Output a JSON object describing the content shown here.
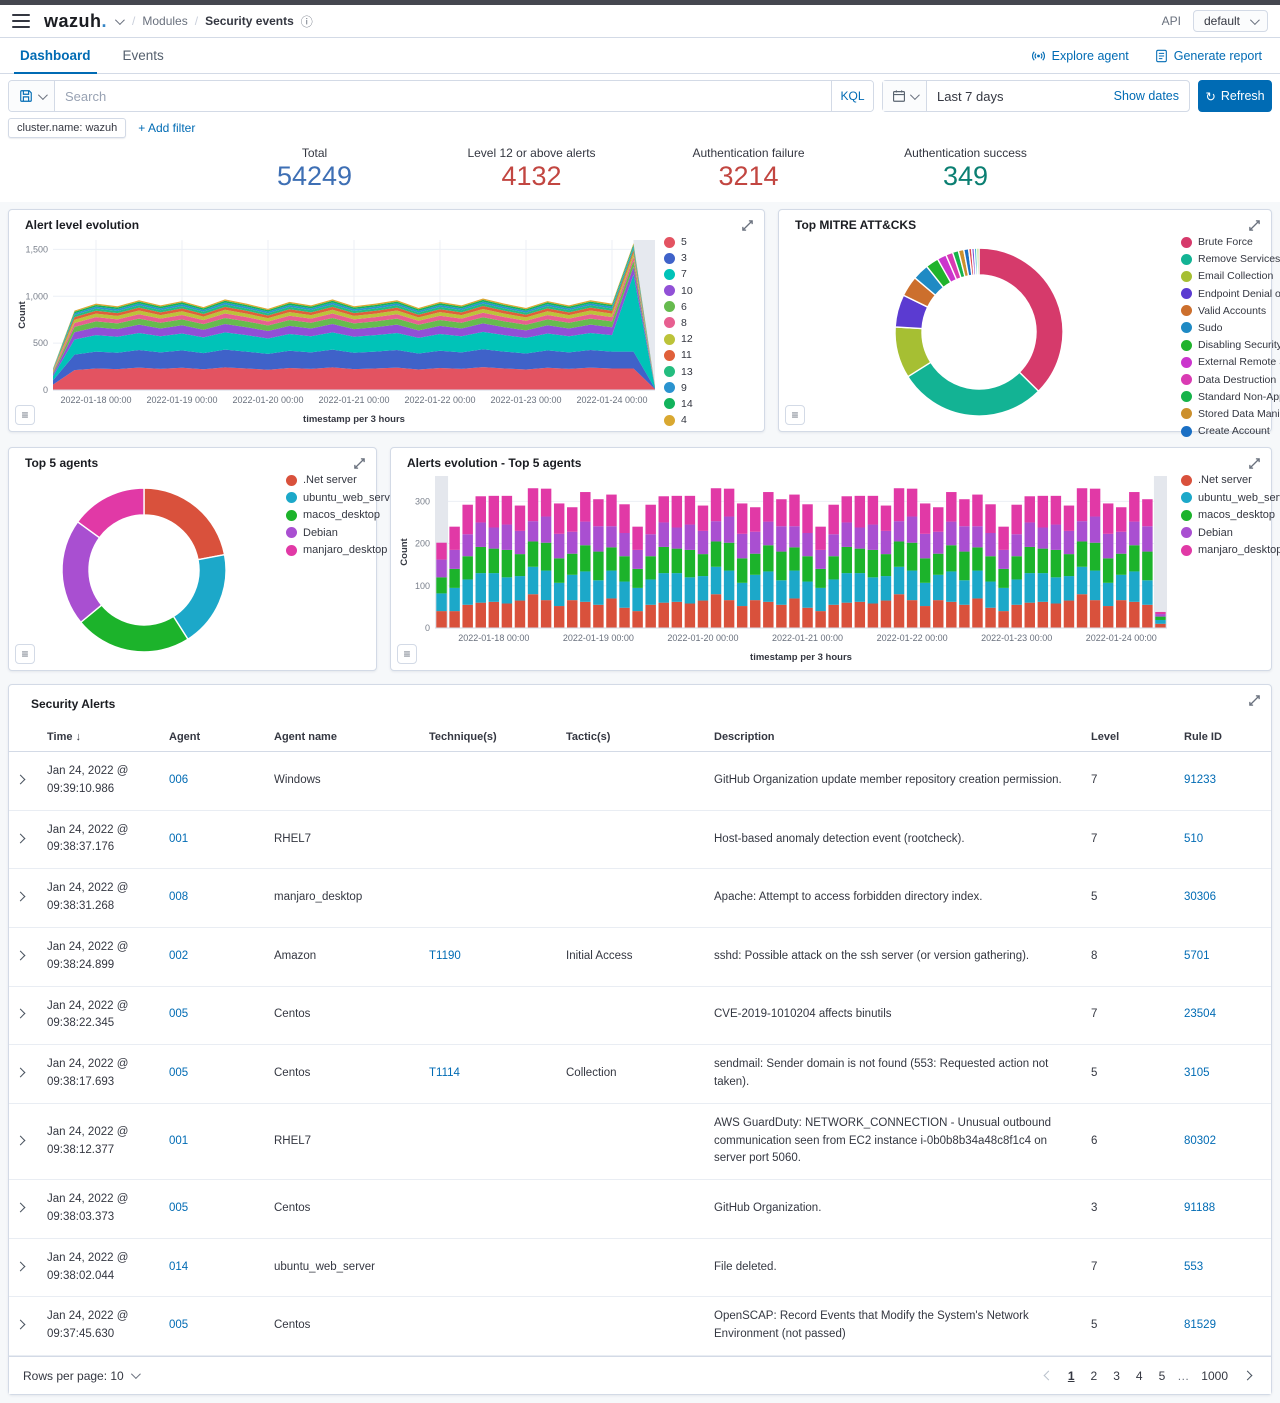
{
  "chrome": {
    "logo_text": "wazuh",
    "logo_dot": ".",
    "breadcrumb": {
      "section": "Modules",
      "current": "Security events"
    },
    "info_glyph": "ⓘ",
    "api_label": "API",
    "api_value": "default"
  },
  "tabs": {
    "items": [
      {
        "label": "Dashboard",
        "active": true
      },
      {
        "label": "Events",
        "active": false
      }
    ],
    "explore_agent": "Explore agent",
    "generate_report": "Generate report"
  },
  "query": {
    "search_placeholder": "Search",
    "kql_label": "KQL",
    "time_range": "Last 7 days",
    "show_dates": "Show dates",
    "refresh_label": "Refresh",
    "refresh_glyph": "↻",
    "filter_chip": "cluster.name: wazuh",
    "add_filter": "+ Add filter"
  },
  "stats": [
    {
      "label": "Total",
      "value": "54249",
      "color": "#3e6fb4"
    },
    {
      "label": "Level 12 or above alerts",
      "value": "4132",
      "color": "#c24641"
    },
    {
      "label": "Authentication failure",
      "value": "3214",
      "color": "#c24641"
    },
    {
      "label": "Authentication success",
      "value": "349",
      "color": "#0b7f72"
    }
  ],
  "chart_data": [
    {
      "id": "alert-level-evolution",
      "type": "area",
      "title": "Alert level evolution",
      "xlabel": "timestamp per 3 hours",
      "ylabel": "Count",
      "ylim": [
        0,
        1600
      ],
      "yticks": [
        0,
        500,
        1000,
        1500
      ],
      "ytick_labels": [
        "0",
        "500",
        "1,000",
        "1,500"
      ],
      "x_points": 29,
      "xtick_indices": [
        2,
        6,
        10,
        14,
        18,
        22,
        26
      ],
      "xtick_labels": [
        "2022-01-18 00:00",
        "2022-01-19 00:00",
        "2022-01-20 00:00",
        "2022-01-21 00:00",
        "2022-01-22 00:00",
        "2022-01-23 00:00",
        "2022-01-24 00:00"
      ],
      "wave": [
        0.25,
        0.92,
        1.0,
        0.97,
        1.04,
        0.98,
        1.03,
        0.96,
        1.05,
        1.0,
        0.94,
        1.02,
        0.98,
        1.05,
        0.97,
        1.0,
        1.04,
        0.95,
        1.02,
        0.98,
        1.06,
        1.0,
        0.95,
        1.03,
        0.98,
        1.04,
        1.0,
        1.0,
        0.04
      ],
      "series": [
        {
          "name": "5",
          "color": "#e35361",
          "base": 230
        },
        {
          "name": "3",
          "color": "#3f62c9",
          "base": 180
        },
        {
          "name": "7",
          "color": "#00c3b8",
          "base": 175
        },
        {
          "name": "10",
          "color": "#9150d6",
          "base": 85
        },
        {
          "name": "6",
          "color": "#66bb4e",
          "base": 62
        },
        {
          "name": "8",
          "color": "#e75f90",
          "base": 45
        },
        {
          "name": "12",
          "color": "#bcc339",
          "base": 38
        },
        {
          "name": "11",
          "color": "#e0603a",
          "base": 30
        },
        {
          "name": "13",
          "color": "#24bd7f",
          "base": 24
        },
        {
          "name": "9",
          "color": "#2a93cf",
          "base": 20
        },
        {
          "name": "14",
          "color": "#12b35c",
          "base": 18
        },
        {
          "name": "4",
          "color": "#d9a831",
          "base": 14
        }
      ],
      "spike": {
        "series": "7",
        "index": 27,
        "value": 820
      },
      "end_band_from_index": 27,
      "legend_position": "right"
    },
    {
      "id": "top-mitre",
      "type": "donut",
      "title": "Top MITRE ATT&CKS",
      "slices": [
        {
          "label": "Brute Force",
          "value": 36,
          "color": "#d63a6b"
        },
        {
          "label": "Remove Services",
          "value": 27.5,
          "color": "#13b394"
        },
        {
          "label": "Email Collection",
          "value": 9.5,
          "color": "#a6bf33"
        },
        {
          "label": "Endpoint Denial of S...",
          "value": 6,
          "color": "#5b3bd1"
        },
        {
          "label": "Valid Accounts",
          "value": 3.8,
          "color": "#cc6f2d"
        },
        {
          "label": "Sudo",
          "value": 3.0,
          "color": "#1f8ac4"
        },
        {
          "label": "Disabling Security T...",
          "value": 2.4,
          "color": "#20b32c"
        },
        {
          "label": "External Remote Se...",
          "value": 1.7,
          "color": "#cb35cd"
        },
        {
          "label": "Data Destruction",
          "value": 1.3,
          "color": "#d93bb3"
        },
        {
          "label": "Standard Non-Appli...",
          "value": 1.1,
          "color": "#16b34a"
        },
        {
          "label": "Stored Data Manipu...",
          "value": 1.0,
          "color": "#cc902d"
        },
        {
          "label": "Create Account",
          "value": 0.9,
          "color": "#1a6fc4"
        },
        {
          "label": "",
          "value": 0.55,
          "color": "#e0484f"
        },
        {
          "label": "",
          "value": 0.5,
          "color": "#7f56d6"
        },
        {
          "label": "",
          "value": 0.45,
          "color": "#2bb3c7"
        },
        {
          "label": "",
          "value": 0.4,
          "color": "#9ed14f"
        }
      ]
    },
    {
      "id": "top5-agents",
      "type": "donut",
      "title": "Top 5 agents",
      "slices": [
        {
          "label": ".Net server",
          "value": 22,
          "color": "#d9513c"
        },
        {
          "label": "ubuntu_web_server",
          "value": 19,
          "color": "#1ca8c9"
        },
        {
          "label": "macos_desktop",
          "value": 23,
          "color": "#1cb32b"
        },
        {
          "label": "Debian",
          "value": 21,
          "color": "#a94fd1"
        },
        {
          "label": "manjaro_desktop",
          "value": 15,
          "color": "#e139a6"
        }
      ]
    },
    {
      "id": "alerts-evolution",
      "type": "stacked_bar",
      "title": "Alerts evolution - Top 5 agents",
      "xlabel": "timestamp per 3 hours",
      "ylabel": "Count",
      "ylim": [
        0,
        360
      ],
      "yticks": [
        0,
        100,
        200,
        300
      ],
      "ytick_labels": [
        "0",
        "100",
        "200",
        "300"
      ],
      "bars": 56,
      "xtick_indices": [
        4,
        12,
        20,
        28,
        36,
        44,
        52
      ],
      "xtick_labels": [
        "2022-01-18 00:00",
        "2022-01-19 00:00",
        "2022-01-20 00:00",
        "2022-01-21 00:00",
        "2022-01-22 00:00",
        "2022-01-23 00:00",
        "2022-01-24 00:00"
      ],
      "series": [
        {
          "name": ".Net server",
          "color": "#d9513c",
          "pattern": [
            40,
            55,
            60,
            62,
            58,
            65,
            80,
            66,
            52,
            66,
            62,
            55,
            70,
            48
          ],
          "first": 40,
          "last": 10
        },
        {
          "name": "ubuntu_web_server",
          "color": "#1ca8c9",
          "pattern": [
            55,
            60,
            70,
            68,
            62,
            58,
            65,
            70,
            55,
            60,
            72,
            58,
            66,
            62
          ],
          "first": 42,
          "last": 9
        },
        {
          "name": "macos_desktop",
          "color": "#1cb32b",
          "pattern": [
            45,
            55,
            62,
            58,
            65,
            52,
            60,
            66,
            58,
            50,
            62,
            68,
            55,
            60
          ],
          "first": 38,
          "last": 8
        },
        {
          "name": "Debian",
          "color": "#a94fd1",
          "pattern": [
            45,
            52,
            58,
            50,
            60,
            55,
            48,
            62,
            58,
            52,
            56,
            60,
            50,
            55
          ],
          "first": 42,
          "last": 6
        },
        {
          "name": "manjaro_desktop",
          "color": "#e139a6",
          "pattern": [
            55,
            70,
            62,
            75,
            68,
            60,
            78,
            66,
            72,
            58,
            70,
            64,
            75,
            68
          ],
          "first": 40,
          "last": 5
        }
      ],
      "partial_bucket_bars": [
        0,
        55
      ]
    }
  ],
  "table": {
    "title": "Security Alerts",
    "columns": [
      "Time",
      "Agent",
      "Agent name",
      "Technique(s)",
      "Tactic(s)",
      "Description",
      "Level",
      "Rule ID"
    ],
    "sorted_column": "Time",
    "sort_glyph": "↓",
    "rows": [
      {
        "time": "Jan 24, 2022 @ 09:39:10.986",
        "agent": "006",
        "agent_name": "Windows",
        "technique": "",
        "tactic": "",
        "description": "GitHub Organization update member repository creation permission.",
        "level": "7",
        "rule_id": "91233"
      },
      {
        "time": "Jan 24, 2022 @ 09:38:37.176",
        "agent": "001",
        "agent_name": "RHEL7",
        "technique": "",
        "tactic": "",
        "description": "Host-based anomaly detection event (rootcheck).",
        "level": "7",
        "rule_id": "510"
      },
      {
        "time": "Jan 24, 2022 @ 09:38:31.268",
        "agent": "008",
        "agent_name": "manjaro_desktop",
        "technique": "",
        "tactic": "",
        "description": "Apache: Attempt to access forbidden directory index.",
        "level": "5",
        "rule_id": "30306"
      },
      {
        "time": "Jan 24, 2022 @ 09:38:24.899",
        "agent": "002",
        "agent_name": "Amazon",
        "technique": "T1190",
        "tactic": "Initial Access",
        "description": "sshd: Possible attack on the ssh server (or version gathering).",
        "level": "8",
        "rule_id": "5701"
      },
      {
        "time": "Jan 24, 2022 @ 09:38:22.345",
        "agent": "005",
        "agent_name": "Centos",
        "technique": "",
        "tactic": "",
        "description": "CVE-2019-1010204 affects binutils",
        "level": "7",
        "rule_id": "23504"
      },
      {
        "time": "Jan 24, 2022 @ 09:38:17.693",
        "agent": "005",
        "agent_name": "Centos",
        "technique": "T1114",
        "tactic": "Collection",
        "description": "sendmail: Sender domain is not found (553: Requested action not taken).",
        "level": "5",
        "rule_id": "3105"
      },
      {
        "time": "Jan 24, 2022 @ 09:38:12.377",
        "agent": "001",
        "agent_name": "RHEL7",
        "technique": "",
        "tactic": "",
        "description": "AWS GuardDuty: NETWORK_CONNECTION - Unusual outbound communication seen from EC2 instance i-0b0b8b34a48c8f1c4 on server port 5060.",
        "level": "6",
        "rule_id": "80302"
      },
      {
        "time": "Jan 24, 2022 @ 09:38:03.373",
        "agent": "005",
        "agent_name": "Centos",
        "technique": "",
        "tactic": "",
        "description": "GitHub Organization.",
        "level": "3",
        "rule_id": "91188"
      },
      {
        "time": "Jan 24, 2022 @ 09:38:02.044",
        "agent": "014",
        "agent_name": "ubuntu_web_server",
        "technique": "",
        "tactic": "",
        "description": "File deleted.",
        "level": "7",
        "rule_id": "553"
      },
      {
        "time": "Jan 24, 2022 @ 09:37:45.630",
        "agent": "005",
        "agent_name": "Centos",
        "technique": "",
        "tactic": "",
        "description": "OpenSCAP: Record Events that Modify the System's Network Environment (not passed)",
        "level": "5",
        "rule_id": "81529"
      }
    ]
  },
  "pagination": {
    "rows_per_page_label": "Rows per page: 10",
    "pages": [
      "1",
      "2",
      "3",
      "4",
      "5",
      "…",
      "1000"
    ],
    "active_page": "1",
    "ellipsis_index": 5
  }
}
